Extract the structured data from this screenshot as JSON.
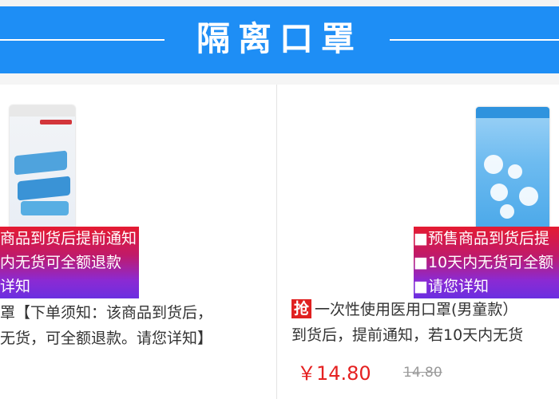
{
  "header": {
    "title": "隔离口罩"
  },
  "products": [
    {
      "promo_lines": [
        "商品到货后提前通知",
        "内无货可全额退款",
        "详知"
      ],
      "desc_line1": "罩【下单须知：该商品到货后，",
      "desc_line2": "无货，可全额退款。请您详知】"
    },
    {
      "promo_lines": [
        "■预售商品到货后提",
        "■10天内无货可全额",
        "■请您详知"
      ],
      "flash_badge": "抢",
      "desc_line1": "一次性使用医用口罩(男童款）",
      "desc_line2": "到货后，提前通知，若10天内无货",
      "price": "￥14.80",
      "old_price": "14.80"
    }
  ],
  "colors": {
    "header_bg": "#1e8ef5",
    "price": "#e52121",
    "badge": "#e02020"
  }
}
